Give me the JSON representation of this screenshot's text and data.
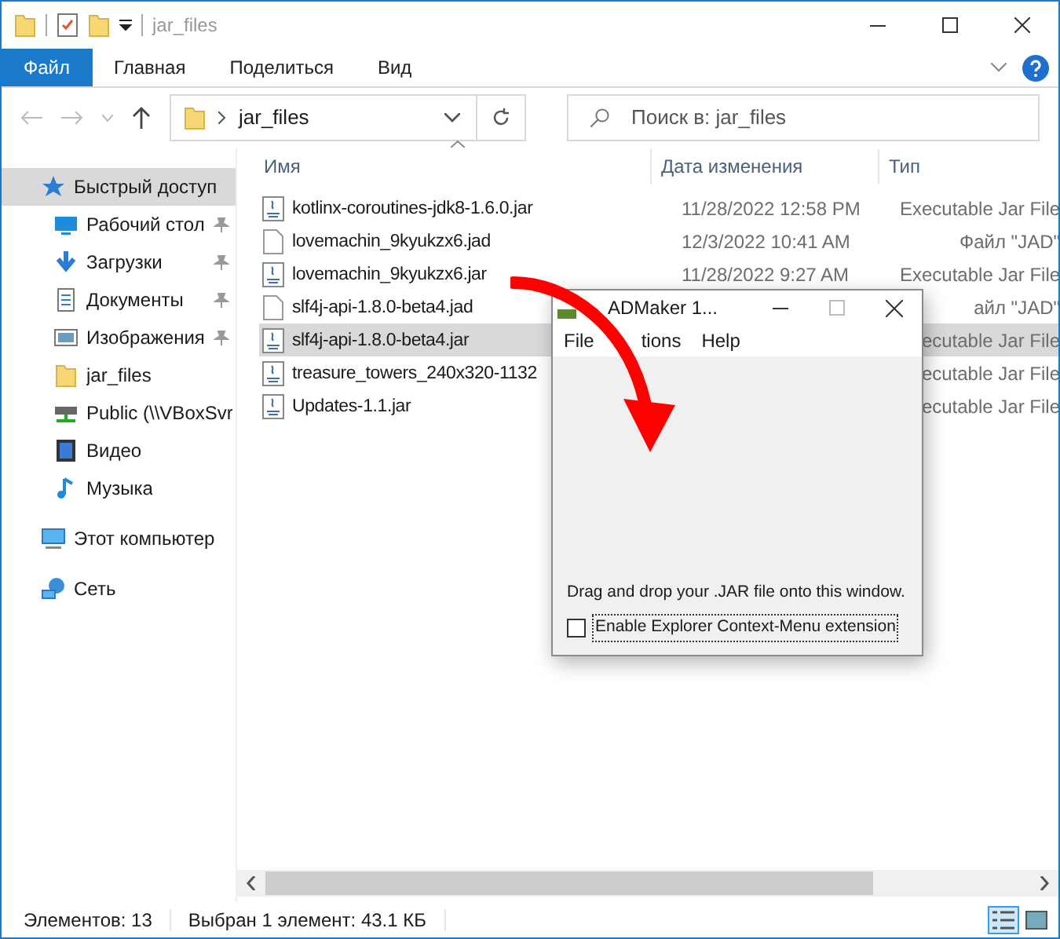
{
  "window": {
    "title": "jar_files"
  },
  "ribbon_tabs": [
    {
      "label": "Файл",
      "selected": true
    },
    {
      "label": "Главная",
      "selected": false
    },
    {
      "label": "Поделиться",
      "selected": false
    },
    {
      "label": "Вид",
      "selected": false
    }
  ],
  "address": {
    "path": "jar_files"
  },
  "search": {
    "placeholder": "Поиск в: jar_files"
  },
  "nav": [
    {
      "label": "Быстрый доступ",
      "kind": "star",
      "selected": true,
      "children": [
        {
          "label": "Рабочий стол",
          "kind": "desktop",
          "pinned": true,
          "selected": false
        },
        {
          "label": "Загрузки",
          "kind": "download",
          "pinned": true,
          "selected": false
        },
        {
          "label": "Документы",
          "kind": "document",
          "pinned": true,
          "selected": false
        },
        {
          "label": "Изображения",
          "kind": "picture",
          "pinned": true,
          "selected": false
        },
        {
          "label": "jar_files",
          "kind": "folder",
          "pinned": false,
          "selected": false
        },
        {
          "label": "Public (\\\\VBoxSvr",
          "kind": "drive",
          "pinned": false,
          "selected": false
        },
        {
          "label": "Видео",
          "kind": "video",
          "pinned": false,
          "selected": false
        },
        {
          "label": "Музыка",
          "kind": "music",
          "pinned": false,
          "selected": false
        }
      ]
    },
    {
      "label": "Этот компьютер",
      "kind": "computer",
      "selected": false
    },
    {
      "label": "Сеть",
      "kind": "network",
      "selected": false
    }
  ],
  "columns": [
    "Имя",
    "Дата изменения",
    "Тип"
  ],
  "files": [
    {
      "kind": "jar",
      "name": "kotlinx-coroutines-jdk8-1.6.0.jar",
      "date": "11/28/2022 12:58 PM",
      "type": "Executable Jar File",
      "selected": false
    },
    {
      "kind": "jad",
      "name": "lovemachin_9kyukzx6.jad",
      "date": "12/3/2022 10:41 AM",
      "type": "Файл \"JAD\"",
      "selected": false
    },
    {
      "kind": "jar",
      "name": "lovemachin_9kyukzx6.jar",
      "date": "11/28/2022 9:27 AM",
      "type": "Executable Jar File",
      "selected": false
    },
    {
      "kind": "jad",
      "name": "slf4j-api-1.8.0-beta4.jad",
      "type": "айл \"JAD\"",
      "selected": false
    },
    {
      "kind": "jar",
      "name": "slf4j-api-1.8.0-beta4.jar",
      "type": "ecutable Jar File",
      "selected": true
    },
    {
      "kind": "jar",
      "name": "treasure_towers_240x320-1132",
      "type": "ecutable Jar File",
      "selected": false
    },
    {
      "kind": "jar",
      "name": "Updates-1.1.jar",
      "type": "ecutable Jar File",
      "selected": false
    }
  ],
  "status_bar": {
    "count": "Элементов: 13",
    "selection": "Выбран 1 элемент: 43.1 КБ"
  },
  "views": [
    {
      "kind": "details",
      "selected": true
    },
    {
      "kind": "tiles",
      "selected": false
    }
  ],
  "dialog": {
    "title": "ADMaker 1...",
    "menu": [
      "File",
      "tions",
      "Help"
    ],
    "hint": "Drag and drop your .JAR file onto this window.",
    "checkbox": {
      "label": "Enable Explorer Context-Menu extension",
      "checked": false
    }
  }
}
